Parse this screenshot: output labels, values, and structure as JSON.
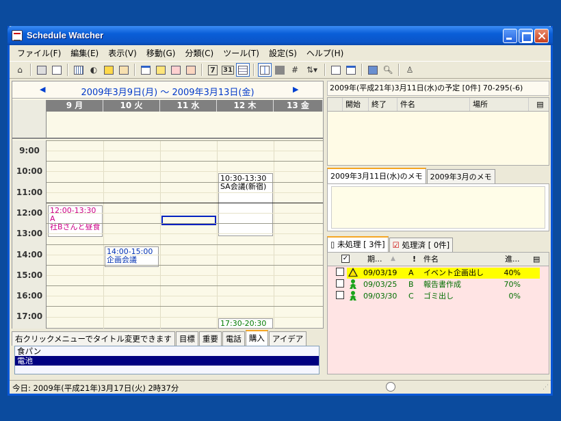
{
  "window": {
    "title": "Schedule Watcher"
  },
  "menu": [
    "ファイル(F)",
    "編集(E)",
    "表示(V)",
    "移動(G)",
    "分類(C)",
    "ツール(T)",
    "設定(S)",
    "ヘルプ(H)"
  ],
  "toolbar": {
    "btn7": "7",
    "btn31": "31"
  },
  "calendar": {
    "range": "2009年3月9日(月) ～ 2009年3月13日(金)",
    "prev": "◀",
    "next": "▶",
    "days": [
      "9 月",
      "10 火",
      "11 水",
      "12 木",
      "13 金"
    ],
    "times": [
      "9:00",
      "10:00",
      "11:00",
      "12:00",
      "13:00",
      "14:00",
      "15:00",
      "16:00",
      "17:00"
    ],
    "events": [
      {
        "time": "12:00-13:30 A",
        "title": "社Bさんと昼食",
        "color": "#cc0088"
      },
      {
        "time": "14:00-15:00",
        "title": "企画会議",
        "color": "#0030b0"
      },
      {
        "time": "10:30-13:30",
        "title": "SA会議(新宿)",
        "color": "#000000"
      },
      {
        "time": "17:30-20:30",
        "title": "",
        "color": "#007a00"
      }
    ]
  },
  "memo": {
    "tabs": [
      "右クリックメニューでタイトル変更できます",
      "目標",
      "重要",
      "電話",
      "購入",
      "アイデア"
    ],
    "items": [
      "食パン",
      "電池"
    ]
  },
  "status": {
    "today": "今日: 2009年(平成21年)3月17日(火) 2時37分"
  },
  "schedule": {
    "header": "2009年(平成21年)3月11日(水)の予定 [0件] 70-295(-6)",
    "columns": [
      "開始",
      "終了",
      "件名",
      "場所"
    ]
  },
  "daymemo": {
    "tabs": [
      "2009年3月11日(水)のメモ",
      "2009年3月のメモ"
    ]
  },
  "todo": {
    "tabs": [
      "未処理 [ 3件]",
      "処理済 [ 0件]"
    ],
    "columns": {
      "due": "期...",
      "priority": "!",
      "name": "件名",
      "progress": "進..."
    },
    "rows": [
      {
        "due": "09/03/19",
        "pri": "A",
        "name": "イベント企画出し",
        "prog": "40%",
        "color": "#000000",
        "highlight": "#ffff00"
      },
      {
        "due": "09/03/25",
        "pri": "B",
        "name": "報告書作成",
        "prog": "70%",
        "color": "#006e00",
        "highlight": ""
      },
      {
        "due": "09/03/30",
        "pri": "C",
        "name": "ゴミ出し",
        "prog": "0%",
        "color": "#006e00",
        "highlight": ""
      }
    ]
  }
}
